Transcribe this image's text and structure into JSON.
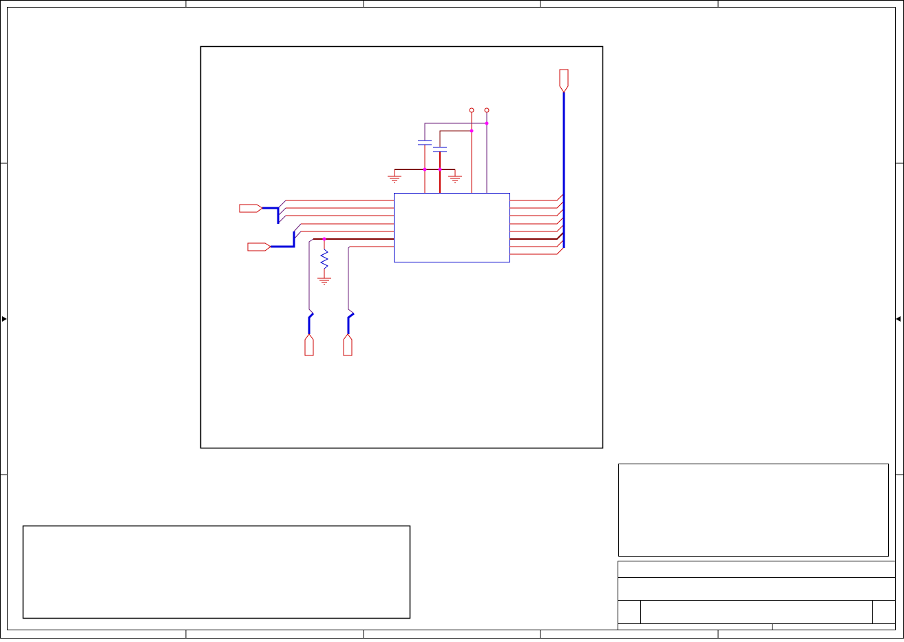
{
  "title_block": {
    "title": "",
    "size": "",
    "document_number": "",
    "rev": "",
    "date": "",
    "sheet": ""
  },
  "notes": {
    "left_notes_text": "",
    "right_notes_text": ""
  },
  "schematic": {
    "ic_reference": "",
    "ic_value": "",
    "ports": {
      "left_top": "",
      "left_bottom": "",
      "bottom_left": "",
      "bottom_right": "",
      "top_right": ""
    },
    "power_labels": {
      "rail_a": "",
      "rail_b": ""
    }
  },
  "colors": {
    "frame": "#000000",
    "wire": "#cc0000",
    "wire_dark": "#800000",
    "wire_purple": "#6a1b7a",
    "bus": "#0000dd",
    "junction": "#ff00ff",
    "component": "#0000cc"
  }
}
